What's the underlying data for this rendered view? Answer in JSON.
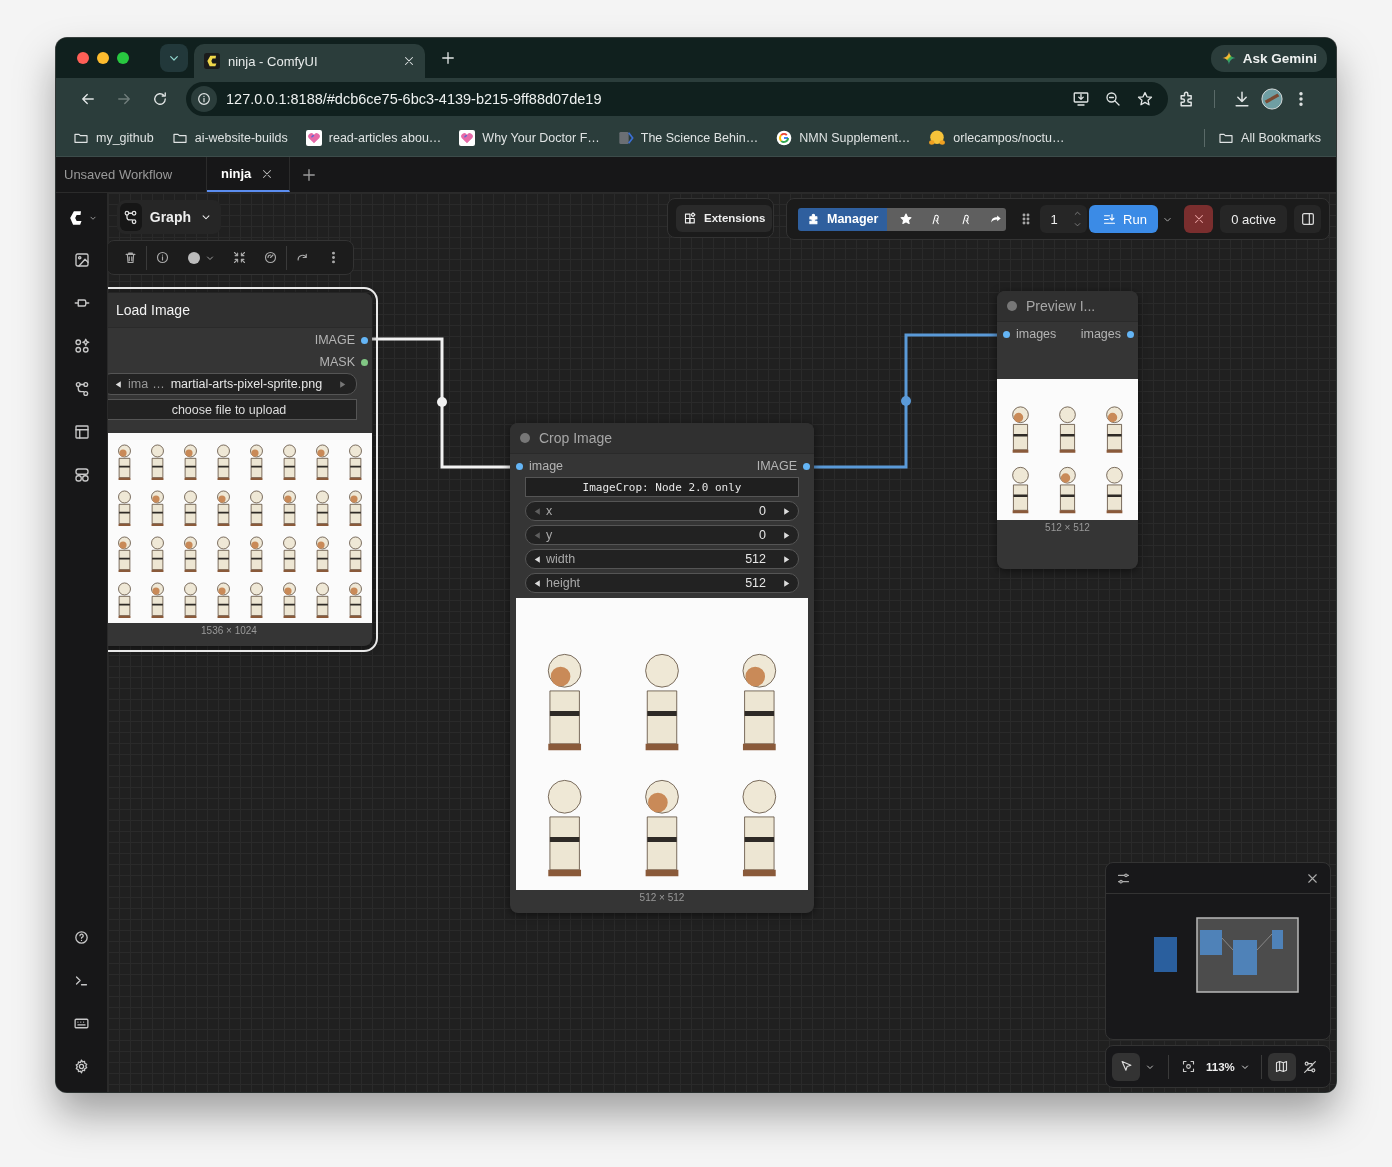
{
  "browser": {
    "tab": {
      "title": "ninja - ComfyUI"
    },
    "ask_button": "Ask Gemini",
    "nav": {
      "forward_disabled": true
    },
    "address": {
      "url": "127.0.0.1:8188/#dcb6ce75-6bc3-4139-b215-9ff88d07de19"
    },
    "bookmarks": [
      {
        "kind": "folder",
        "label": "my_github"
      },
      {
        "kind": "folder",
        "label": "ai-website-builds"
      },
      {
        "kind": "heart",
        "label": "read-articles abou…"
      },
      {
        "kind": "heart",
        "label": "Why Your Doctor F…"
      },
      {
        "kind": "page",
        "label": "The Science Behin…"
      },
      {
        "kind": "google",
        "label": "NMN Supplement…"
      },
      {
        "kind": "hug",
        "label": "orlecampos/noctu…"
      }
    ],
    "all_bookmarks": "All Bookmarks"
  },
  "workflow_tabs": [
    {
      "label": "Unsaved Workflow",
      "selected": false
    },
    {
      "label": "ninja",
      "selected": true
    }
  ],
  "graph_menu": "Graph",
  "top_toolbar": {
    "extensions": "Extensions",
    "manager": "Manager",
    "queue_count": "1",
    "run": "Run",
    "active_count": "0 active"
  },
  "nodes": [
    {
      "kind": "load",
      "title": "Load Image",
      "selected": true,
      "outputs": [
        {
          "label": "IMAGE",
          "color": "#64b5f6"
        },
        {
          "label": "MASK",
          "color": "#81c784"
        }
      ],
      "combo": {
        "label": "ima",
        "ellipsis": "…",
        "value": "martial-arts-pixel-sprite.png"
      },
      "upload_button": "choose file to upload",
      "image_size": "1536 × 1024"
    },
    {
      "kind": "crop",
      "title": "Crop Image",
      "selected": false,
      "inputs": [
        {
          "label": "image",
          "color": "#64b5f6"
        }
      ],
      "outputs": [
        {
          "label": "IMAGE",
          "color": "#64b5f6"
        }
      ],
      "note": "ImageCrop: Node 2.0 only",
      "widgets": [
        {
          "label": "x",
          "value": "0",
          "at_min": true
        },
        {
          "label": "y",
          "value": "0",
          "at_min": true
        },
        {
          "label": "width",
          "value": "512",
          "at_min": false
        },
        {
          "label": "height",
          "value": "512",
          "at_min": false
        }
      ],
      "image_size": "512 × 512"
    },
    {
      "kind": "preview",
      "title": "Preview I...",
      "selected": false,
      "inputs": [
        {
          "label": "images",
          "color": "#64b5f6"
        }
      ],
      "outputs": [
        {
          "label": "images",
          "color": "#64b5f6"
        }
      ],
      "image_size": "512 × 512"
    }
  ],
  "canvas_controls": {
    "zoom": "113%",
    "select_mode": true,
    "minimap": true
  }
}
